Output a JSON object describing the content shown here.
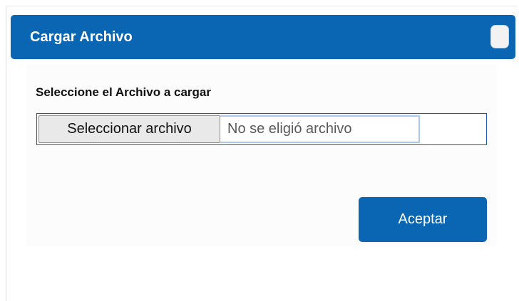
{
  "dialog": {
    "title": "Cargar Archivo"
  },
  "form": {
    "label": "Seleccione el Archivo a cargar",
    "file_button_label": "Seleccionar archivo",
    "file_status": "No se eligió archivo"
  },
  "actions": {
    "accept_label": "Aceptar"
  },
  "colors": {
    "accent": "#0a66b2",
    "title_text": "#ffffff"
  }
}
